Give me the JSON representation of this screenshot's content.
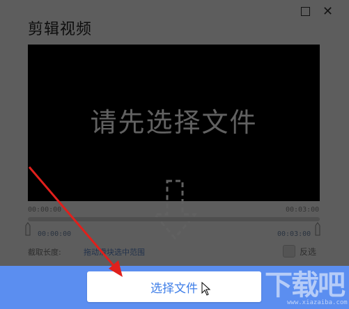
{
  "window": {
    "title": "剪辑视频",
    "close_glyph": "✕"
  },
  "player": {
    "message": "请先选择文件"
  },
  "timeline": {
    "start_top": "00:00:00",
    "end_top": "00:03:00",
    "start_bottom": "00:00:00",
    "end_bottom": "00:03:00"
  },
  "clip": {
    "length_label": "截取长度:",
    "length_hint": "拖动滑块选中范围",
    "invert_label": "反选"
  },
  "footer": {
    "select_button_label": "选择文件"
  },
  "watermark": {
    "main": "下载吧",
    "sub": "www.xiazaiba.com"
  },
  "colors": {
    "accent": "#5b8ef0",
    "button_text": "#3e7ee8",
    "annotation_arrow": "#e0201c"
  },
  "icons": [
    "maximize-icon",
    "close-icon",
    "dashed-down-arrow-icon",
    "slider-handle-icon",
    "cursor-icon",
    "red-annotation-arrow"
  ]
}
